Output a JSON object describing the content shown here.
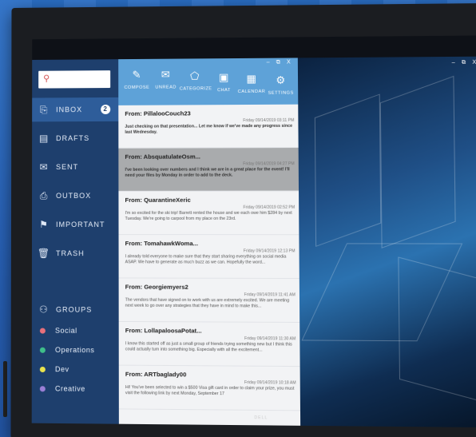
{
  "search": {
    "icon": "search-icon",
    "glyph": "⚲"
  },
  "window_controls": "– ⧉ X",
  "photo_window_controls": "– ⧉ X",
  "sidebar": {
    "items": [
      {
        "label": "INBOX",
        "icon": "inbox-icon",
        "glyph": "⎘",
        "badge": "2"
      },
      {
        "label": "DRAFTS",
        "icon": "drafts-icon",
        "glyph": "▤"
      },
      {
        "label": "SENT",
        "icon": "sent-icon",
        "glyph": "✉"
      },
      {
        "label": "OUTBOX",
        "icon": "outbox-icon",
        "glyph": "⎙"
      },
      {
        "label": "IMPORTANT",
        "icon": "flag-icon",
        "glyph": "⚑"
      },
      {
        "label": "TRASH",
        "icon": "trash-icon",
        "glyph": "🗑"
      }
    ],
    "groups_label": "GROUPS",
    "groups": [
      {
        "label": "Social",
        "color": "#e8707b"
      },
      {
        "label": "Operations",
        "color": "#3fbf8a"
      },
      {
        "label": "Dev",
        "color": "#e9e34d"
      },
      {
        "label": "Creative",
        "color": "#9b7fd6"
      }
    ]
  },
  "toolbar": [
    {
      "label": "COMPOSE",
      "icon": "compose-icon",
      "glyph": "✎"
    },
    {
      "label": "UNREAD",
      "icon": "unread-icon",
      "glyph": "✉"
    },
    {
      "label": "CATEGORIZE",
      "icon": "tag-icon",
      "glyph": "⬠"
    },
    {
      "label": "CHAT",
      "icon": "chat-icon",
      "glyph": "▣"
    },
    {
      "label": "CALENDAR",
      "icon": "calendar-icon",
      "glyph": "▦"
    },
    {
      "label": "SETTINGS",
      "icon": "gear-icon",
      "glyph": "⚙"
    }
  ],
  "messages": [
    {
      "from": "From: PillalooCouch23",
      "date": "Friday 09/14/2019 03:11 PM",
      "preview": "Just checking on that presentation... Let me know if we've made any progress since last Wednesday."
    },
    {
      "from": "From: AbsquatulateOsm...",
      "date": "Friday 09/14/2019 04:27 PM",
      "preview": "I've been looking over numbers and I think we are in a great place for the event! I'll need your files by Monday in order to add to the deck."
    },
    {
      "from": "From: QuarantineXeric",
      "date": "Friday 09/14/2019 02:52 PM",
      "preview": "I'm so excited for the ski trip! Barrett rented the house and we each owe him $284 by next Tuesday. We're going to carpool from my place on the 23rd."
    },
    {
      "from": "From: TomahawkWoma...",
      "date": "Friday 09/14/2019 12:13 PM",
      "preview": "I already told everyone to make sure that they start sharing everything on social media ASAP. We have to generate as much buzz as we can. Hopefully the word..."
    },
    {
      "from": "From: Georgiemyers2",
      "date": "Friday 09/14/2019 11:41 AM",
      "preview": "The vendors that have signed on to work with us are extremely excited. We are meeting next week to go over any strategies that they have in mind to make this..."
    },
    {
      "from": "From: LollapaloosaPotat...",
      "date": "Friday 09/14/2019 11:30 AM",
      "preview": "I know this started off as just a small group of friends trying something new but I think this could actually turn into something big. Especially with all the excitement..."
    },
    {
      "from": "From: ARTbaglady00",
      "date": "Friday 09/14/2019 10:18 AM",
      "preview": "Hi! You've been selected to win a $500 Visa gift card in order to claim your prize, you must visit the following link by next Monday, September 17"
    }
  ],
  "brand": "DELL"
}
